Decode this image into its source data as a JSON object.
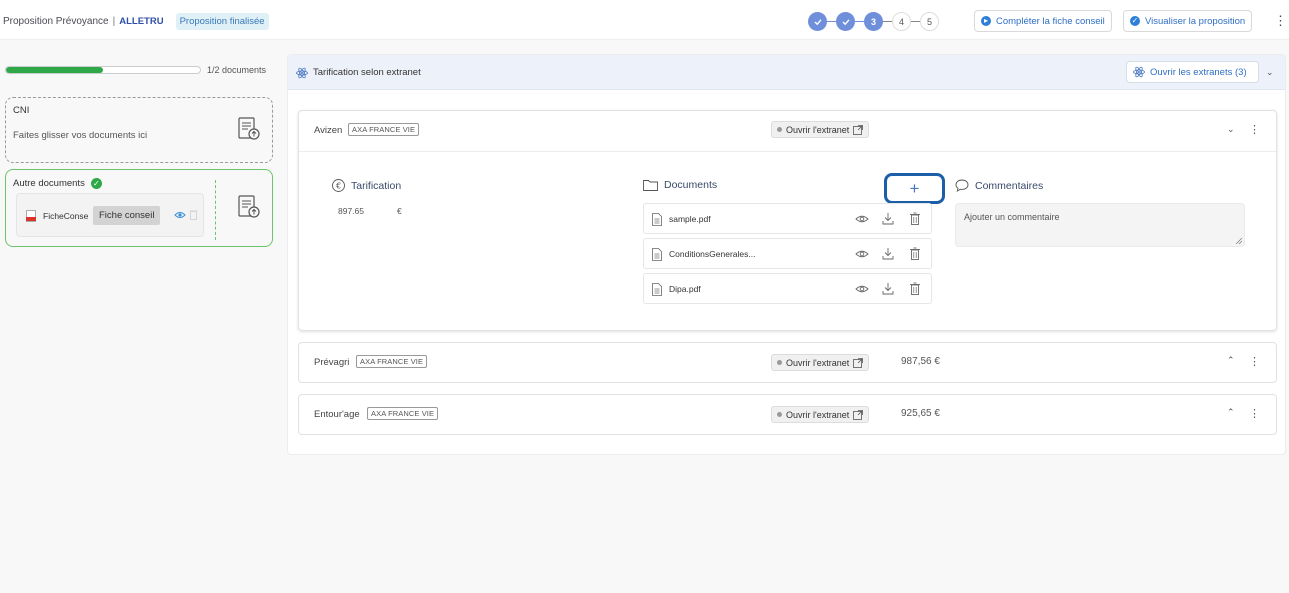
{
  "header": {
    "title": "Proposition Prévoyance",
    "separator": "|",
    "client": "ALLETRU",
    "status_badge": "Proposition finalisée",
    "steps": [
      "",
      "",
      "3",
      "4",
      "5"
    ],
    "btn_fiche": "Compléter la fiche conseil",
    "btn_visualiser": "Visualiser la proposition"
  },
  "left": {
    "progress": {
      "fraction": 0.5,
      "label": "1/2 documents",
      "color": "#2fa84a"
    },
    "cni": {
      "title": "CNI",
      "hint": "Faites glisser vos documents ici"
    },
    "autres": {
      "title": "Autre documents",
      "file_name": "FicheConse",
      "tooltip": "Fiche conseil"
    }
  },
  "panel": {
    "title": "Tarification selon extranet",
    "open_all_label": "Ouvrir les extranets (3)",
    "rows": [
      {
        "insurer": "Avizen",
        "tag": "AXA FRANCE VIE",
        "open_label": "Ouvrir l'extranet",
        "price": "",
        "expanded": true
      },
      {
        "insurer": "Prévagri",
        "tag": "AXA FRANCE VIE",
        "open_label": "Ouvrir l'extranet",
        "price": "987,56 €",
        "expanded": false
      },
      {
        "insurer": "Entour'age",
        "tag": "AXA FRANCE VIE",
        "open_label": "Ouvrir l'extranet",
        "price": "925,65 €",
        "expanded": false
      }
    ],
    "detail": {
      "tarification_title": "Tarification",
      "tarification_value": "897.65",
      "currency": "€",
      "documents_title": "Documents",
      "add_symbol": "+",
      "documents": [
        "sample.pdf",
        "ConditionsGenerales...",
        "Dipa.pdf"
      ],
      "comments_title": "Commentaires",
      "comment_placeholder": "Ajouter un commentaire"
    }
  },
  "colors": {
    "accent": "#2f6fc4",
    "step_done": "#6f8fdb",
    "success": "#2fa84a",
    "panel_header": "#edf2fa",
    "highlight_border": "#1b5fa8"
  },
  "icons": [
    "check-icon",
    "plus-circle-icon",
    "atom-icon",
    "chevron-down-icon",
    "chevron-up-icon",
    "kebab-icon",
    "euro-icon",
    "folder-icon",
    "comment-icon",
    "document-icon",
    "eye-icon",
    "download-icon",
    "trash-icon",
    "external-link-icon",
    "pdf-icon",
    "upload-document-icon"
  ]
}
